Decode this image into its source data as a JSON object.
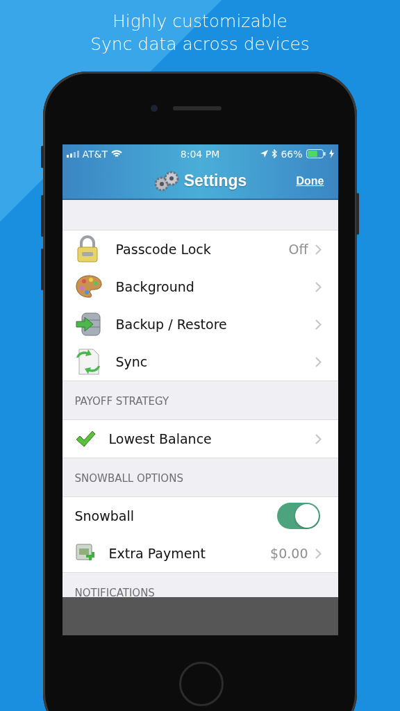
{
  "headline": [
    "Highly customizable",
    "Sync data across devices"
  ],
  "status_bar": {
    "carrier": "AT&T",
    "time": "8:04 PM",
    "battery": "66%",
    "level": 0.66
  },
  "nav": {
    "title": "Settings",
    "done": "Done"
  },
  "sections": [
    {
      "rows": [
        {
          "kind": "link",
          "label": "Passcode Lock",
          "value": "Off"
        },
        {
          "kind": "link",
          "label": "Background"
        },
        {
          "kind": "link",
          "label": "Backup / Restore"
        },
        {
          "kind": "link",
          "label": "Sync"
        }
      ]
    },
    {
      "header": "PAYOFF STRATEGY",
      "rows": [
        {
          "kind": "link",
          "label": "Lowest Balance"
        }
      ]
    },
    {
      "header": "SNOWBALL OPTIONS",
      "rows": [
        {
          "kind": "toggle",
          "label": "Snowball",
          "on": true
        },
        {
          "kind": "link",
          "label": "Extra Payment",
          "value": "$0.00"
        }
      ]
    },
    {
      "header": "NOTIFICATIONS"
    }
  ]
}
